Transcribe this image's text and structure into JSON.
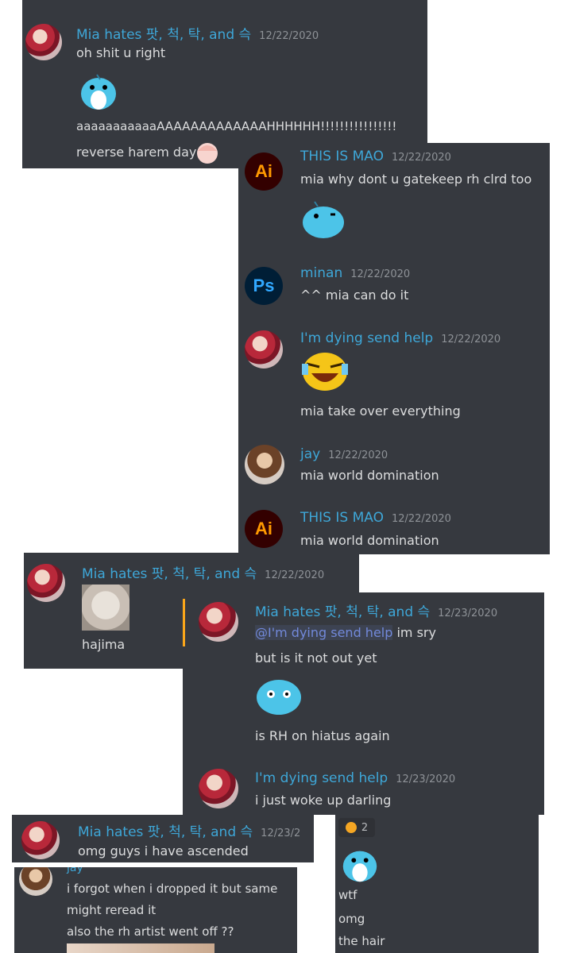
{
  "panel1": {
    "username": "Mia hates 팟, 척, 탁, and 슥",
    "timestamp": "12/22/2020",
    "line1": "oh shit u right",
    "line2": "aaaaaaaaaaaAAAAAAAAAAAAAHHHHHH!!!!!!!!!!!!!!!!",
    "line3": "reverse harem day",
    "sticker_icon": "blue-bird-sticker-icon"
  },
  "panel2": {
    "messages": [
      {
        "username": "THIS IS MAO",
        "timestamp": "12/22/2020",
        "text": "mia why dont u gatekeep rh clrd too",
        "avatar": "Ai"
      },
      {
        "username": "minan",
        "timestamp": "12/22/2020",
        "text": "^^ mia can do it",
        "avatar": "Ps"
      },
      {
        "username": "I'm dying send help",
        "timestamp": "12/22/2020",
        "text": "mia take over everything"
      },
      {
        "username": "jay",
        "timestamp": "12/22/2020",
        "text": "mia world domination"
      },
      {
        "username": "THIS IS MAO",
        "timestamp": "12/22/2020",
        "text": "mia world domination",
        "avatar": "Ai"
      }
    ]
  },
  "panel3": {
    "username": "Mia hates 팟, 척, 탁, and 슥",
    "timestamp": "12/22/2020",
    "text": "hajima"
  },
  "panel4": {
    "username": "Mia hates 팟, 척, 탁, and 슥",
    "timestamp": "12/23/2020",
    "mention": "@I'm dying send help",
    "line1_rest": " im sry",
    "line2": "but is it not out yet",
    "line3": "is RH on hiatus again",
    "reply_username": "I'm dying send help",
    "reply_timestamp": "12/23/2020",
    "reply_text": "i just woke up darling"
  },
  "panel5": {
    "username": "Mia hates 팟, 척, 탁, and 슥",
    "timestamp": "12/23/2",
    "text": "omg guys i have ascended"
  },
  "panel6": {
    "reaction_count": "2",
    "line1": "wtf",
    "line2": "omg",
    "line3": "the hair"
  },
  "panel7": {
    "username_partial": "jay",
    "line1": "i forgot when i dropped it but same",
    "line2": "might reread it",
    "line3": "also the rh artist went off ??"
  },
  "colors": {
    "background": "#36393f",
    "username": "#3ea7d8",
    "text": "#dcddde",
    "timestamp": "#8e9297",
    "mention_bar": "#faa61a"
  }
}
